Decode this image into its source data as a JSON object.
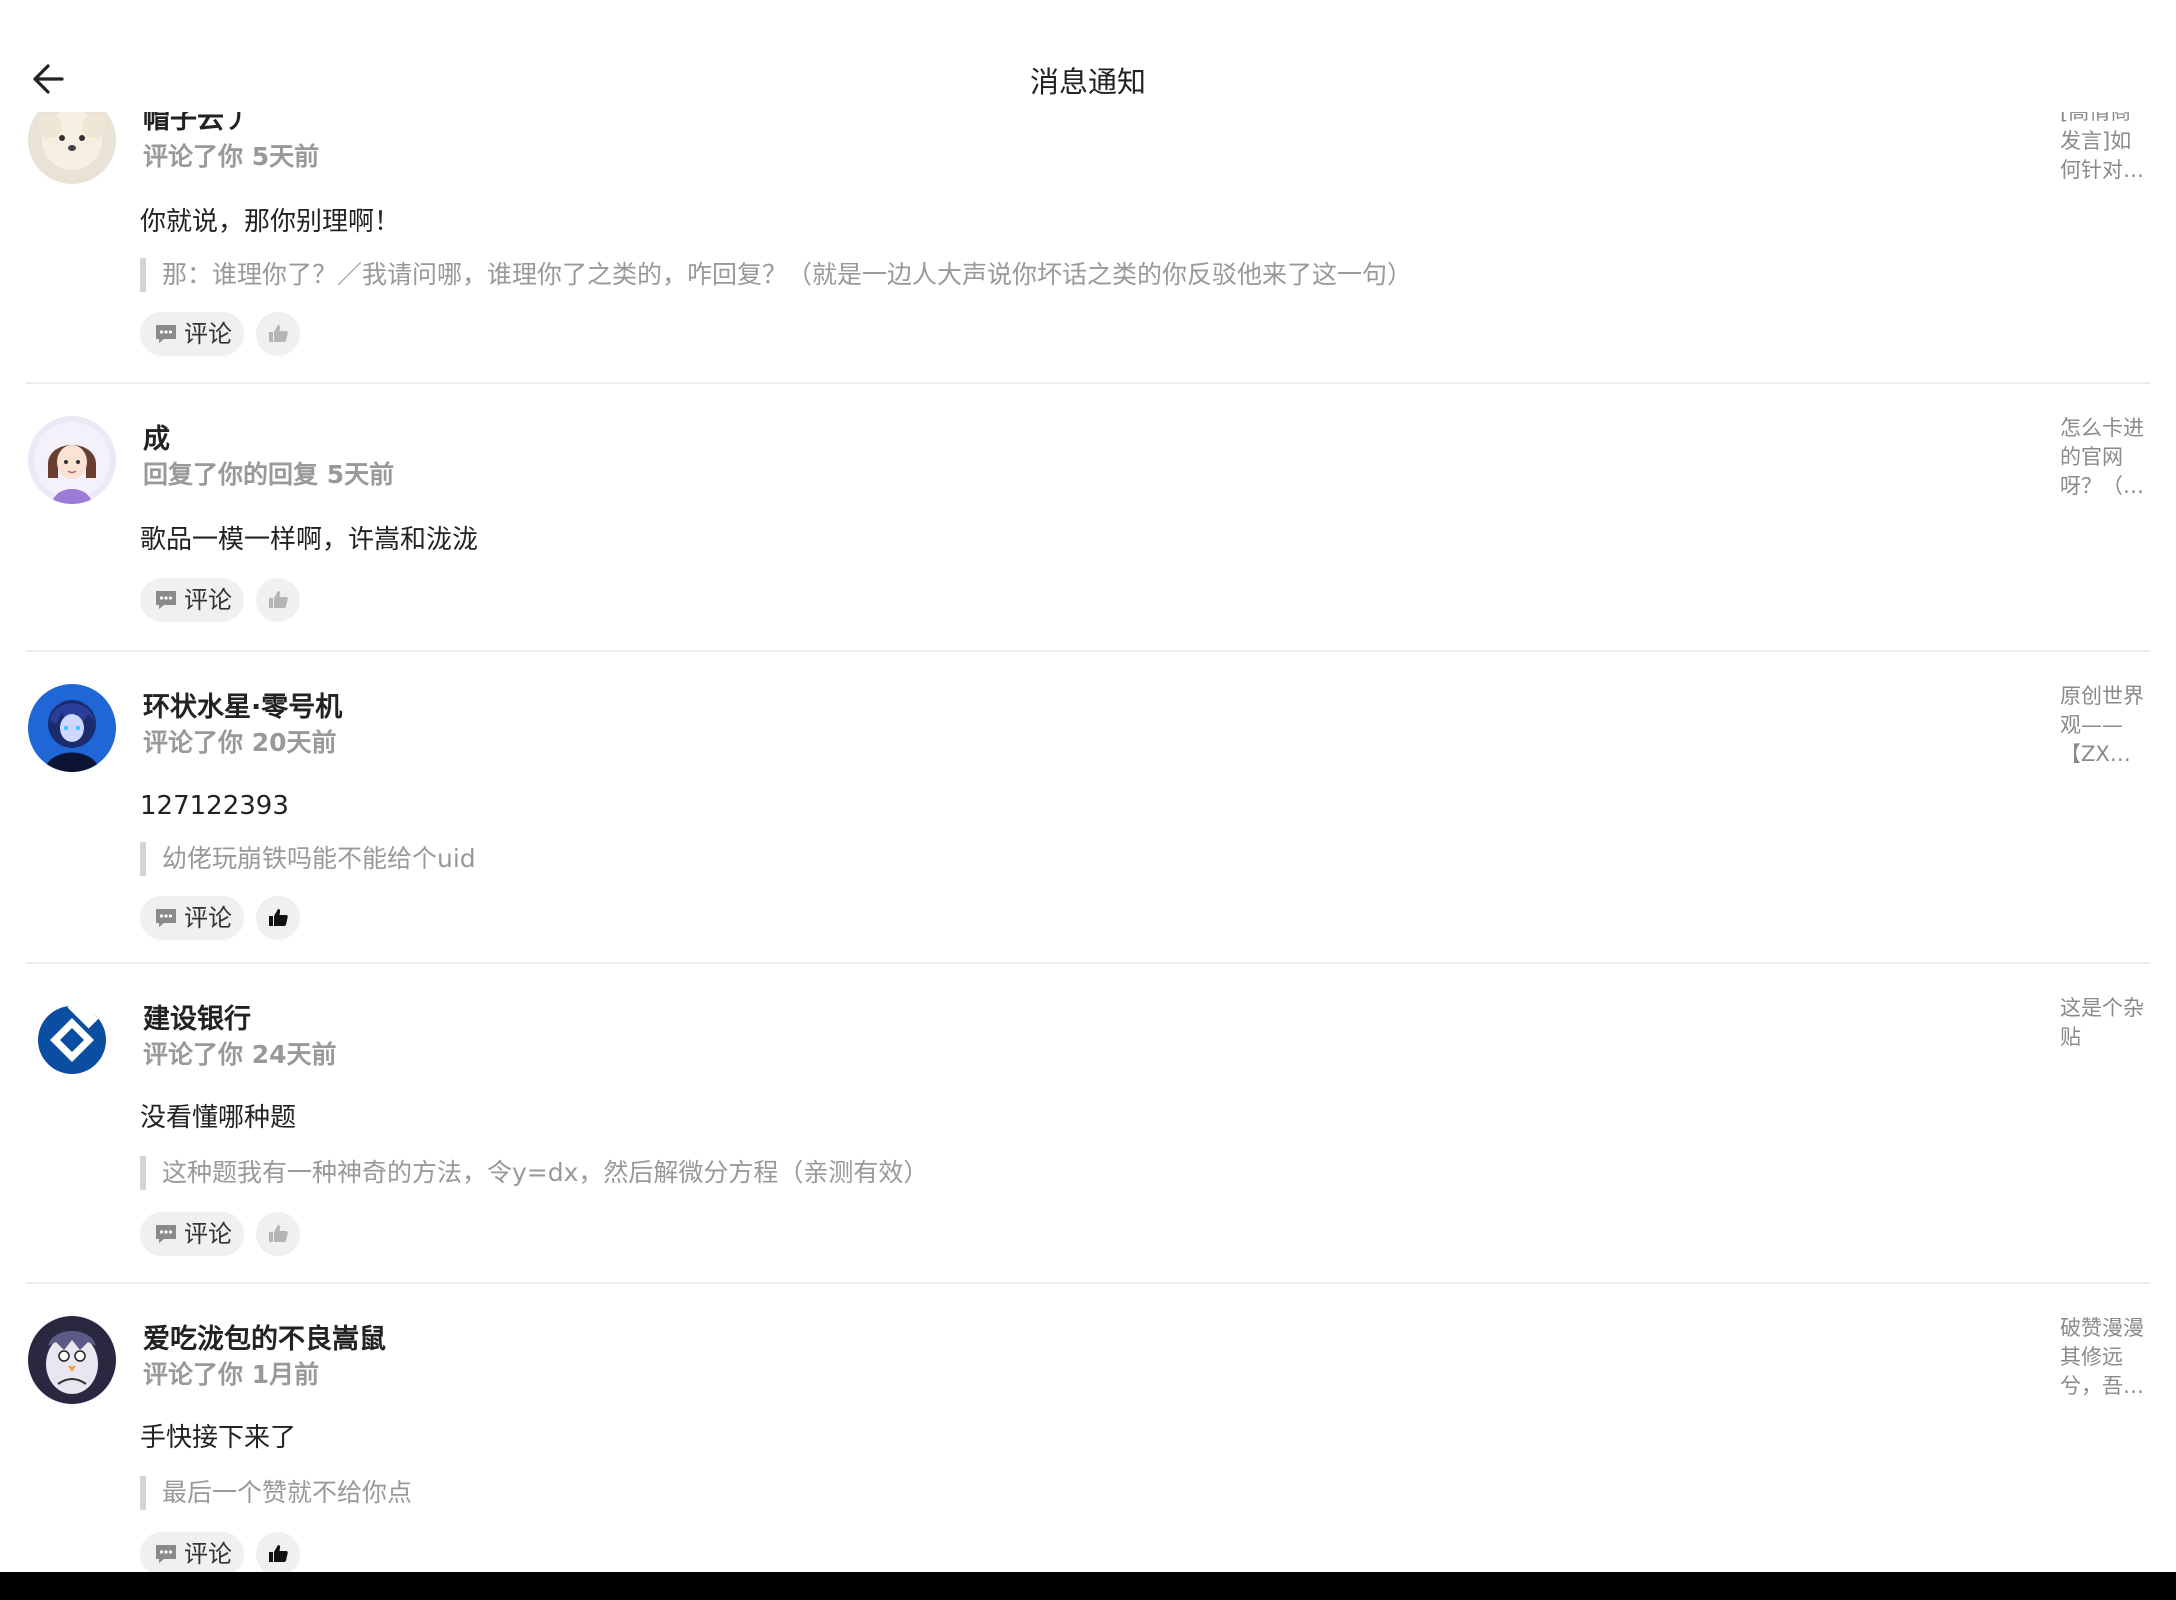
{
  "header": {
    "title": "消息通知",
    "back_icon": "arrow-left-icon"
  },
  "buttons": {
    "comment_label": "评论"
  },
  "notifications": [
    {
      "user": "帽子云丿",
      "action": "评论了你 5天前",
      "content": "你就说，那你别理啊！",
      "quote": "那：谁理你了？／我请问哪，谁理你了之类的，咋回复？（就是一边人大声说你坏话之类的你反驳他来了这一句）",
      "source": "[高情商\n发言]如\n何针对…",
      "liked": false,
      "avatar": "avatar-dog"
    },
    {
      "user": "成",
      "action": "回复了你的回复 5天前",
      "content": "歌品一模一样啊，许嵩和泷泷",
      "quote": "",
      "source": "怎么卡进\n的官网\n呀？（…",
      "liked": false,
      "avatar": "avatar-girl"
    },
    {
      "user": "环状水星·零号机",
      "action": "评论了你 20天前",
      "content": "127122393",
      "quote": "幼佬玩崩铁吗能不能给个uid",
      "source": "原创世界\n观——\n【ZX…",
      "liked": true,
      "avatar": "avatar-anime-blue"
    },
    {
      "user": "建设银行",
      "action": "评论了你 24天前",
      "content": "没看懂哪种题",
      "quote": "这种题我有一种神奇的方法，令y=dx，然后解微分方程（亲测有效）",
      "source": "这是个杂\n贴",
      "liked": false,
      "avatar": "avatar-ccb-logo"
    },
    {
      "user": "爱吃泷包的不良嵩鼠",
      "action": "评论了你 1月前",
      "content": "手快接下来了",
      "quote": "最后一个赞就不给你点",
      "source": "破赞漫漫\n其修远\n兮，吾…",
      "liked": true,
      "avatar": "avatar-anime-penguin"
    }
  ]
}
